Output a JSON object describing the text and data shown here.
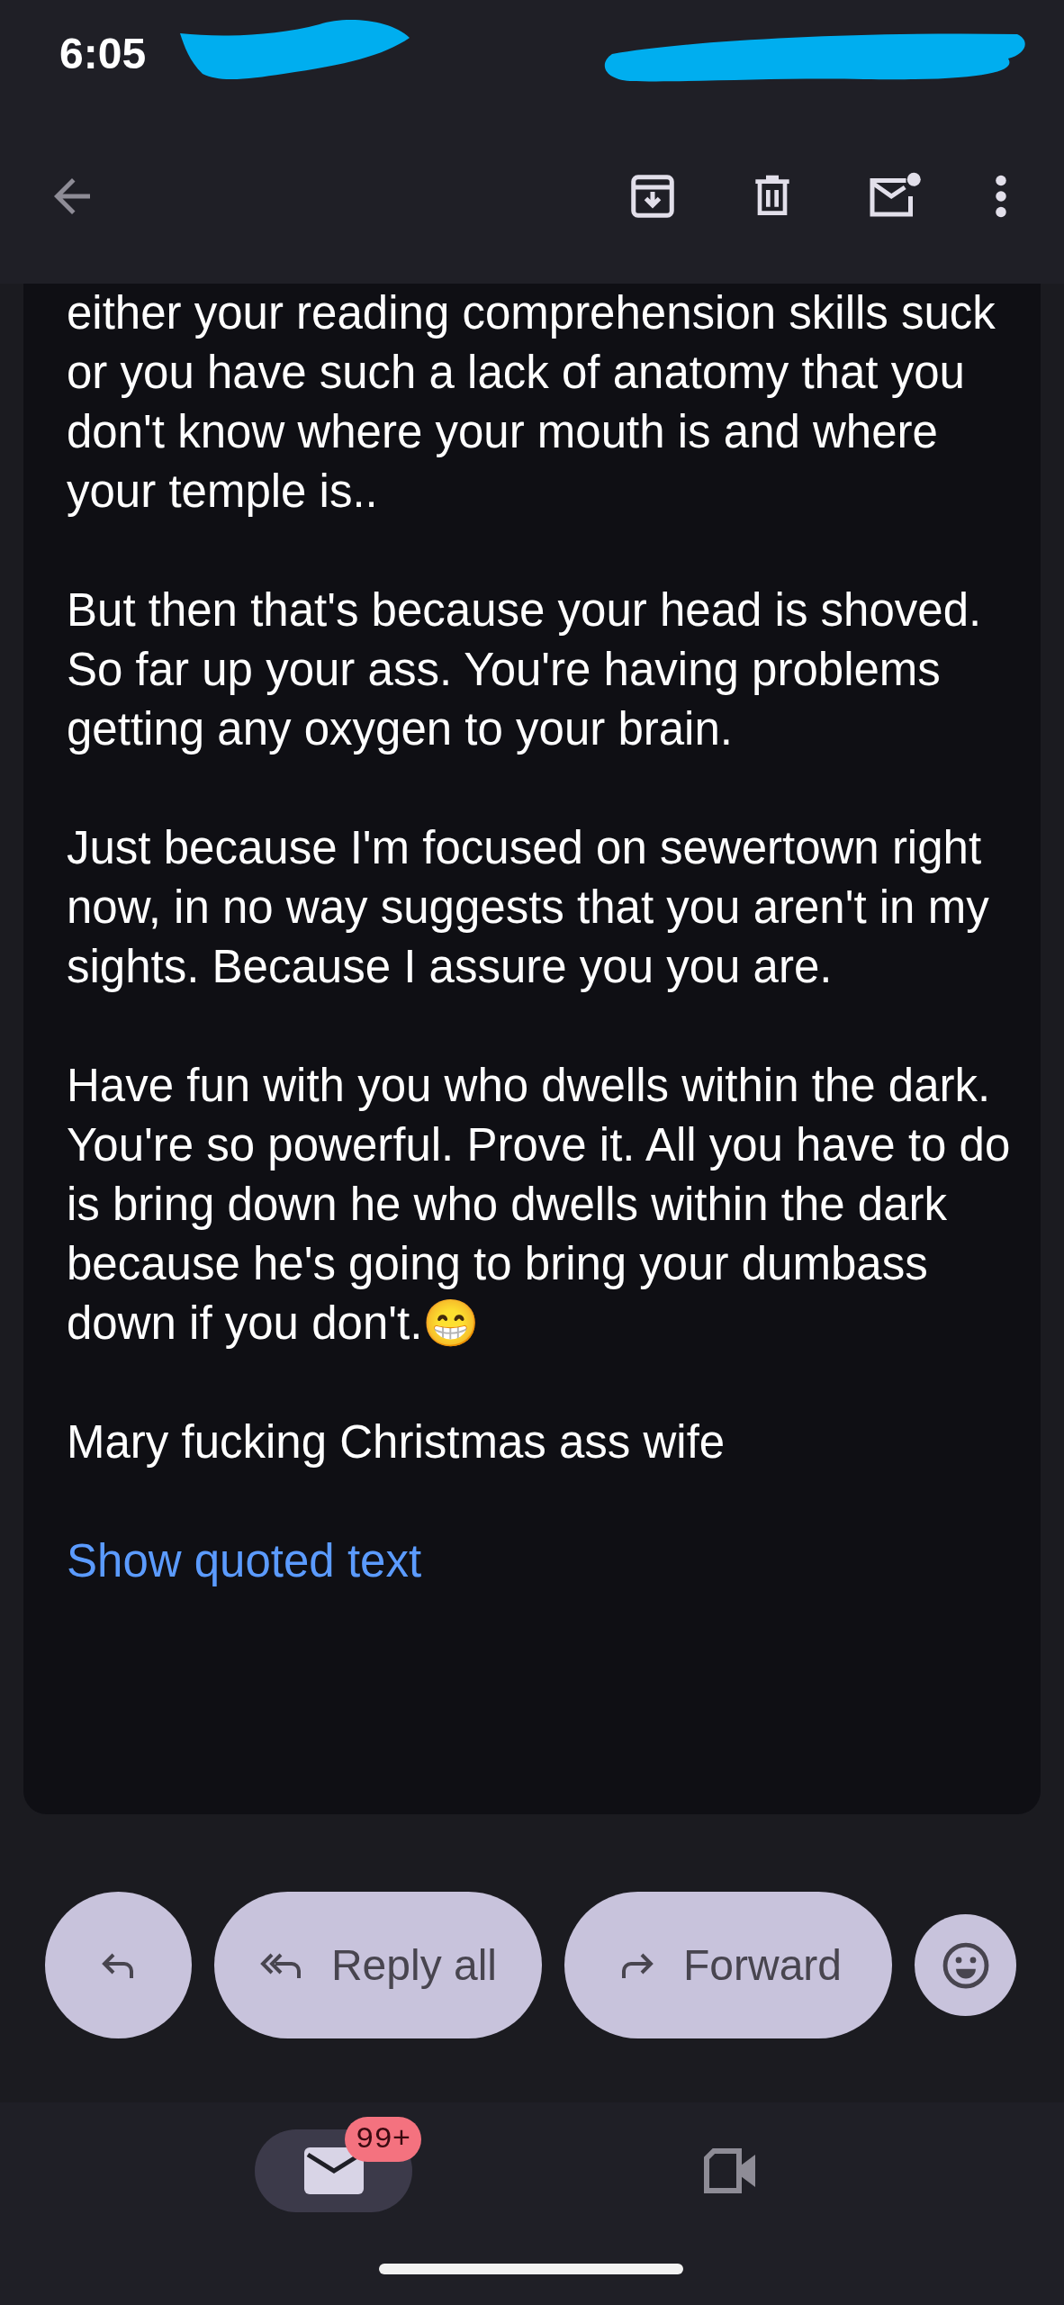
{
  "status_bar": {
    "time": "6:05"
  },
  "email": {
    "paragraphs": [
      "either your reading comprehension skills suck or you have such a lack of anatomy that you don't know where your mouth is and where your temple is..",
      "But then that's because your head is shoved. So far up your ass. You're having problems getting any oxygen to your brain.",
      "Just because I'm focused on sewertown right now, in no way suggests that you aren't in my sights. Because I assure you you are.",
      "Have fun with you who dwells within the dark. You're so powerful. Prove it. All you have to do is bring down he who dwells within the dark because he's going to bring your dumbass down if you don't.😁",
      "Mary fucking Christmas ass wife"
    ],
    "quoted_link": "Show quoted text"
  },
  "actions": [
    {
      "kind": "reply"
    },
    {
      "kind": "reply_all",
      "label": "Reply all"
    },
    {
      "kind": "forward",
      "label": "Forward"
    },
    {
      "kind": "emoji"
    }
  ],
  "bottom_nav": [
    {
      "kind": "mail",
      "selected": true,
      "badge": "99+"
    },
    {
      "kind": "meet",
      "selected": false
    }
  ]
}
